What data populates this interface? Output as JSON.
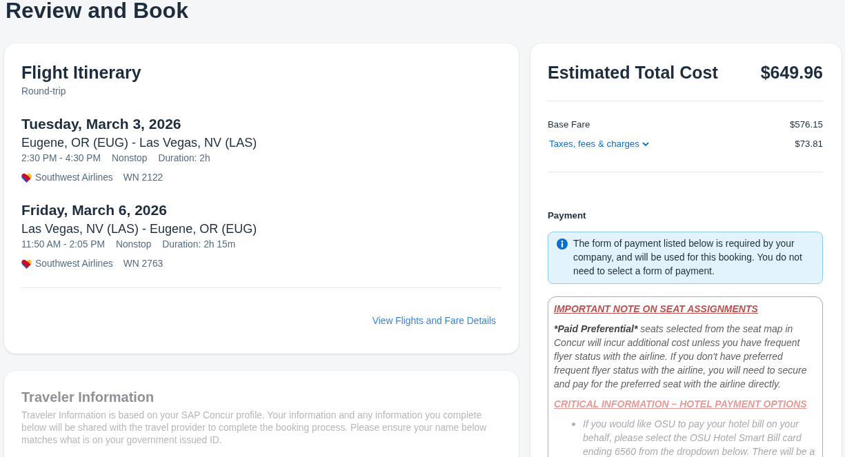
{
  "page": {
    "title": "Review and Book"
  },
  "itinerary": {
    "title": "Flight Itinerary",
    "trip_type": "Round-trip",
    "segments": [
      {
        "date": "Tuesday, March 3, 2026",
        "route": "Eugene, OR (EUG) - Las Vegas, NV (LAS)",
        "times": "2:30 PM - 4:30 PM",
        "stops": "Nonstop",
        "duration": "Duration: 2h",
        "airline": "Southwest Airlines",
        "flight": "WN 2122"
      },
      {
        "date": "Friday, March 6, 2026",
        "route": "Las Vegas, NV (LAS) - Eugene, OR (EUG)",
        "times": "11:50 AM - 2:05 PM",
        "stops": "Nonstop",
        "duration": "Duration: 2h 15m",
        "airline": "Southwest Airlines",
        "flight": "WN 2763"
      }
    ],
    "details_link": "View Flights and Fare Details"
  },
  "cost": {
    "title": "Estimated Total Cost",
    "total": "$649.96",
    "lines": [
      {
        "kind": "plain",
        "label": "Base Fare",
        "amount": "$576.15"
      },
      {
        "kind": "expandable",
        "label": "Taxes, fees & charges",
        "amount": "$73.81",
        "expanded": false
      }
    ]
  },
  "payment": {
    "title": "Payment",
    "info": "The form of payment listed below is required by your company, and will be used for this booking. You do not need to select a form of payment.",
    "note": [
      {
        "kind": "heading",
        "text": "IMPORTANT NOTE ON SEAT ASSIGNMENTS"
      },
      {
        "kind": "paragraph",
        "lead": "*Paid Preferential*",
        "text": "seats selected from the seat map in Concur will incur additional cost unless you have frequent flyer status with the airline. If you don't have preferred frequent flyer status with the airline, you will need to secure and pay for the preferred seat with the airline directly."
      },
      {
        "kind": "heading",
        "text": "CRITICAL INFORMATION – HOTEL PAYMENT OPTIONS"
      },
      {
        "kind": "bullets",
        "items": [
          "If you would like OSU to pay your hotel bill on your behalf, please select the OSU Hotel Smart Bill card ending 6560 from the dropdown below. There will be a"
        ]
      }
    ]
  },
  "traveler_info": {
    "title": "Traveler Information",
    "text": "Traveler Information is based on your SAP Concur profile. Your information and any information you complete below will be shared with the travel provider to complete the booking process. Please ensure your name below matches what is on your government issued ID."
  }
}
